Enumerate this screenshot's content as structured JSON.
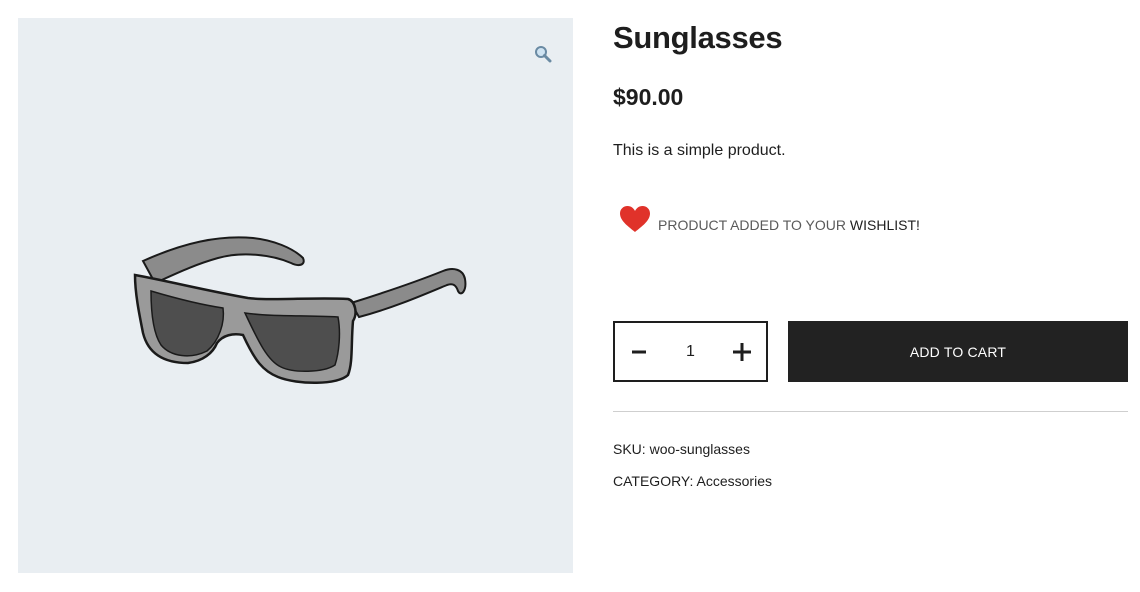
{
  "gallery": {
    "zoom_icon": "magnifier-icon",
    "image_alt": "Sunglasses"
  },
  "product": {
    "title": "Sunglasses",
    "price": "$90.00",
    "description": "This is a simple product."
  },
  "wishlist": {
    "icon": "heart-icon",
    "message": "PRODUCT ADDED TO YOUR ",
    "link_label": "WISHLIST!",
    "heart_color": "#e0322a"
  },
  "quantity": {
    "minus_icon": "minus-icon",
    "value": "1",
    "plus_icon": "plus-icon"
  },
  "cart": {
    "button_label": "ADD TO CART",
    "button_color": "#222222"
  },
  "meta": {
    "sku_label": "SKU:",
    "sku_value": "woo-sunglasses",
    "category_label": "CATEGORY:",
    "category_value": "Accessories"
  },
  "colors": {
    "gallery_bg": "#e9eef2",
    "text": "#1e1e1e"
  }
}
